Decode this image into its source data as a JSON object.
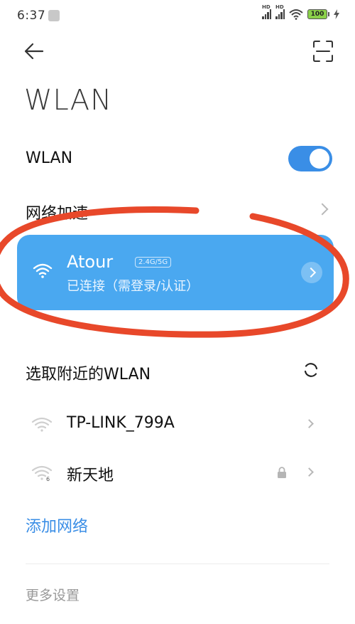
{
  "status_bar": {
    "time": "6:37",
    "hd_label": "HD",
    "battery": "100"
  },
  "header": {
    "title": "WLAN"
  },
  "wlan_toggle": {
    "label": "WLAN",
    "enabled": true
  },
  "network_acceleration": {
    "label": "网络加速"
  },
  "connected": {
    "ssid": "Atour",
    "band": "2.4G/5G",
    "status": "已连接（需登录/认证）"
  },
  "nearby": {
    "heading": "选取附近的WLAN",
    "networks": [
      {
        "ssid": "TP-LINK_799A",
        "secured": false,
        "badge": ""
      },
      {
        "ssid": "新天地",
        "secured": true,
        "badge": "6"
      }
    ]
  },
  "actions": {
    "add_network": "添加网络",
    "more_settings": "更多设置"
  },
  "colors": {
    "accent": "#3a8ee6",
    "card": "#4aa8f0",
    "annotation": "#e8482a"
  }
}
